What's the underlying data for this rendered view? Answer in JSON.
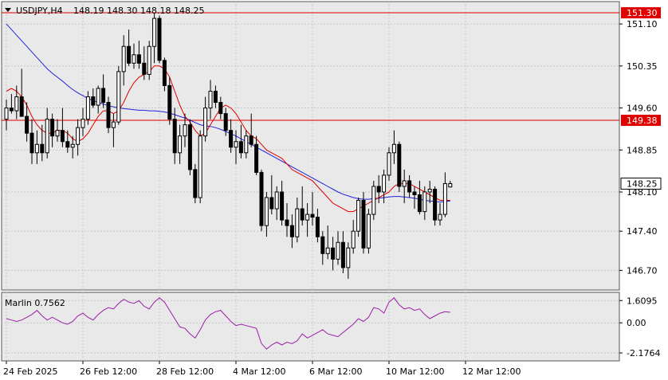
{
  "header": {
    "symbol": "USDJPY,H4",
    "ohlc": "148.19 148.30 148.18 148.25"
  },
  "colors": {
    "background": "#e9e9e9",
    "grid": "#c8c8c8",
    "candle": "#000000",
    "ma_fast": "#e00000",
    "ma_slow": "#2222dd",
    "level": "#e00000",
    "level_label_bg": "#e00000",
    "price_label_bg": "#ffffff",
    "oscillator": "#9b1fa8"
  },
  "chart_data": [
    {
      "type": "candlestick",
      "title": "USDJPY,H4",
      "ylim": [
        146.35,
        151.5
      ],
      "y_ticks": [
        "151.10",
        "150.35",
        "149.60",
        "148.85",
        "148.10",
        "147.40",
        "146.70"
      ],
      "x_ticks": [
        "24 Feb 2025",
        "26 Feb 12:00",
        "28 Feb 12:00",
        "4 Mar 12:00",
        "6 Mar 12:00",
        "10 Mar 12:00",
        "12 Mar 12:00"
      ],
      "x_tick_index": [
        0,
        15,
        30,
        45,
        60,
        75,
        90
      ],
      "horizontal_levels": [
        {
          "label": "151.30",
          "value": 151.3
        },
        {
          "label": "149.38",
          "value": 149.38
        }
      ],
      "current_price": {
        "label": "148.25",
        "value": 148.25
      },
      "candles": [
        [
          149.4,
          149.75,
          149.2,
          149.6
        ],
        [
          149.6,
          149.85,
          149.5,
          149.55
        ],
        [
          149.55,
          150.0,
          149.4,
          149.8
        ],
        [
          149.8,
          150.3,
          149.5,
          149.45
        ],
        [
          149.45,
          149.7,
          149.0,
          149.15
        ],
        [
          149.15,
          149.4,
          148.6,
          148.8
        ],
        [
          148.8,
          149.2,
          148.6,
          148.95
        ],
        [
          148.95,
          149.3,
          148.65,
          148.8
        ],
        [
          148.8,
          149.6,
          148.7,
          149.4
        ],
        [
          149.4,
          149.5,
          148.9,
          149.1
        ],
        [
          149.1,
          149.4,
          149.0,
          149.2
        ],
        [
          149.2,
          149.6,
          148.9,
          149.0
        ],
        [
          149.0,
          149.2,
          148.8,
          148.9
        ],
        [
          148.9,
          149.1,
          148.7,
          148.95
        ],
        [
          148.95,
          149.4,
          148.75,
          149.25
        ],
        [
          149.25,
          149.6,
          149.1,
          149.4
        ],
        [
          149.4,
          149.9,
          149.3,
          149.8
        ],
        [
          149.8,
          149.95,
          149.6,
          149.65
        ],
        [
          149.65,
          150.0,
          149.5,
          149.95
        ],
        [
          149.95,
          150.2,
          149.6,
          149.7
        ],
        [
          149.7,
          149.8,
          149.15,
          149.25
        ],
        [
          149.25,
          149.5,
          148.9,
          149.35
        ],
        [
          149.35,
          150.35,
          149.3,
          150.25
        ],
        [
          150.25,
          150.9,
          150.0,
          150.7
        ],
        [
          150.7,
          151.0,
          150.35,
          150.4
        ],
        [
          150.4,
          150.75,
          150.3,
          150.55
        ],
        [
          150.55,
          150.8,
          150.3,
          150.4
        ],
        [
          150.4,
          150.7,
          150.1,
          150.2
        ],
        [
          150.2,
          150.8,
          150.1,
          150.7
        ],
        [
          150.7,
          151.3,
          150.4,
          151.2
        ],
        [
          151.2,
          151.25,
          150.4,
          150.45
        ],
        [
          150.45,
          150.5,
          149.9,
          150.0
        ],
        [
          150.0,
          150.15,
          149.3,
          149.4
        ],
        [
          149.4,
          149.6,
          148.6,
          148.8
        ],
        [
          148.8,
          149.3,
          148.6,
          149.1
        ],
        [
          149.1,
          149.5,
          148.9,
          149.3
        ],
        [
          149.3,
          149.4,
          148.4,
          148.5
        ],
        [
          148.5,
          148.6,
          147.9,
          148.0
        ],
        [
          148.0,
          149.2,
          147.9,
          149.1
        ],
        [
          149.1,
          149.8,
          149.0,
          149.6
        ],
        [
          149.6,
          150.1,
          149.4,
          149.9
        ],
        [
          149.9,
          150.0,
          149.6,
          149.7
        ],
        [
          149.7,
          149.8,
          149.4,
          149.5
        ],
        [
          149.5,
          149.6,
          149.1,
          149.2
        ],
        [
          149.2,
          149.4,
          148.8,
          148.9
        ],
        [
          148.9,
          149.2,
          148.6,
          149.0
        ],
        [
          149.0,
          149.3,
          148.7,
          148.8
        ],
        [
          148.8,
          149.2,
          148.7,
          149.1
        ],
        [
          149.1,
          149.5,
          148.9,
          148.95
        ],
        [
          148.95,
          149.1,
          148.4,
          148.45
        ],
        [
          148.45,
          148.5,
          147.4,
          147.5
        ],
        [
          147.5,
          148.1,
          147.3,
          148.0
        ],
        [
          148.0,
          148.4,
          147.7,
          147.8
        ],
        [
          147.8,
          148.2,
          147.6,
          148.1
        ],
        [
          148.1,
          148.3,
          147.5,
          147.6
        ],
        [
          147.6,
          147.9,
          147.3,
          147.5
        ],
        [
          147.5,
          147.7,
          147.1,
          147.3
        ],
        [
          147.3,
          148.0,
          147.2,
          147.8
        ],
        [
          147.8,
          148.2,
          147.5,
          147.6
        ],
        [
          147.6,
          147.9,
          147.3,
          147.7
        ],
        [
          147.7,
          148.1,
          147.5,
          147.65
        ],
        [
          147.65,
          147.8,
          147.2,
          147.3
        ],
        [
          147.3,
          147.4,
          146.8,
          147.0
        ],
        [
          147.0,
          147.5,
          146.9,
          147.1
        ],
        [
          147.1,
          147.3,
          146.7,
          146.9
        ],
        [
          146.9,
          147.4,
          146.8,
          147.2
        ],
        [
          147.2,
          147.4,
          146.65,
          146.75
        ],
        [
          146.75,
          147.2,
          146.55,
          147.1
        ],
        [
          147.1,
          147.6,
          147.0,
          147.4
        ],
        [
          147.4,
          148.0,
          147.3,
          147.95
        ],
        [
          147.95,
          148.1,
          147.0,
          147.1
        ],
        [
          147.1,
          147.8,
          147.0,
          147.7
        ],
        [
          147.7,
          148.3,
          147.6,
          148.2
        ],
        [
          148.2,
          148.4,
          147.9,
          148.1
        ],
        [
          148.1,
          148.5,
          147.9,
          148.4
        ],
        [
          148.4,
          148.9,
          148.3,
          148.8
        ],
        [
          148.8,
          149.2,
          148.6,
          148.95
        ],
        [
          148.95,
          149.0,
          148.1,
          148.2
        ],
        [
          148.2,
          148.5,
          147.9,
          148.3
        ],
        [
          148.3,
          148.4,
          148.0,
          148.1
        ],
        [
          148.1,
          148.2,
          147.8,
          148.05
        ],
        [
          148.05,
          148.3,
          147.7,
          147.75
        ],
        [
          147.75,
          148.2,
          147.6,
          148.1
        ],
        [
          148.1,
          148.3,
          147.9,
          148.15
        ],
        [
          148.15,
          148.2,
          147.5,
          147.6
        ],
        [
          147.6,
          147.9,
          147.5,
          147.7
        ],
        [
          147.7,
          148.45,
          147.65,
          148.25
        ],
        [
          148.19,
          148.3,
          148.18,
          148.25
        ]
      ],
      "ma_fast": [
        149.9,
        149.95,
        149.9,
        149.8,
        149.65,
        149.45,
        149.3,
        149.2,
        149.15,
        149.15,
        149.2,
        149.2,
        149.15,
        149.05,
        149.0,
        149.05,
        149.15,
        149.3,
        149.45,
        149.55,
        149.55,
        149.5,
        149.55,
        149.7,
        149.9,
        150.05,
        150.15,
        150.2,
        150.25,
        150.35,
        150.35,
        150.3,
        150.15,
        149.9,
        149.65,
        149.45,
        149.35,
        149.2,
        149.1,
        149.15,
        149.3,
        149.45,
        149.6,
        149.65,
        149.6,
        149.5,
        149.35,
        149.2,
        149.1,
        149.05,
        148.95,
        148.85,
        148.8,
        148.75,
        148.7,
        148.6,
        148.5,
        148.45,
        148.4,
        148.35,
        148.3,
        148.2,
        148.1,
        148.0,
        147.9,
        147.85,
        147.8,
        147.75,
        147.75,
        147.8,
        147.85,
        147.9,
        147.95,
        148.0,
        148.05,
        148.1,
        148.2,
        148.25,
        148.25,
        148.25,
        148.2,
        148.15,
        148.1,
        148.05,
        148.0,
        147.95,
        147.95,
        147.95
      ],
      "ma_slow": [
        151.1,
        151.0,
        150.9,
        150.8,
        150.7,
        150.6,
        150.5,
        150.4,
        150.3,
        150.22,
        150.15,
        150.08,
        150.0,
        149.93,
        149.87,
        149.82,
        149.77,
        149.73,
        149.7,
        149.67,
        149.64,
        149.62,
        149.6,
        149.59,
        149.58,
        149.57,
        149.56,
        149.56,
        149.55,
        149.55,
        149.54,
        149.53,
        149.51,
        149.48,
        149.45,
        149.42,
        149.38,
        149.34,
        149.3,
        149.28,
        149.27,
        149.25,
        149.22,
        149.18,
        149.14,
        149.1,
        149.05,
        149.0,
        148.95,
        148.9,
        148.85,
        148.8,
        148.75,
        148.7,
        148.65,
        148.6,
        148.55,
        148.5,
        148.45,
        148.4,
        148.35,
        148.3,
        148.25,
        148.2,
        148.15,
        148.1,
        148.06,
        148.03,
        148.0,
        147.98,
        147.97,
        147.97,
        147.98,
        147.99,
        148.0,
        148.01,
        148.02,
        148.02,
        148.01,
        148.0,
        147.99,
        147.97,
        147.95,
        147.94,
        147.93,
        147.92,
        147.93,
        147.94
      ]
    },
    {
      "type": "line",
      "title": "Marlin 0.7562",
      "ylim": [
        -2.75,
        2.2
      ],
      "y_ticks": [
        "1.6095",
        "0.00",
        "-2.1764"
      ],
      "series": [
        {
          "values": [
            0.3,
            0.2,
            0.1,
            0.2,
            0.4,
            0.6,
            0.9,
            0.5,
            0.2,
            0.4,
            0.2,
            0.0,
            -0.1,
            0.1,
            0.5,
            0.7,
            0.4,
            0.2,
            0.6,
            0.9,
            1.1,
            1.0,
            1.4,
            1.7,
            1.5,
            1.4,
            1.6,
            1.2,
            1.0,
            1.5,
            1.8,
            1.5,
            0.9,
            0.3,
            -0.3,
            -0.4,
            -0.8,
            -1.1,
            -0.5,
            0.2,
            0.6,
            0.8,
            0.9,
            0.5,
            0.1,
            -0.2,
            -0.1,
            -0.2,
            -0.3,
            -0.4,
            -1.5,
            -1.9,
            -1.6,
            -1.4,
            -1.6,
            -1.4,
            -1.5,
            -1.3,
            -0.8,
            -1.1,
            -0.9,
            -0.7,
            -0.5,
            -0.8,
            -0.9,
            -1.0,
            -0.7,
            -0.4,
            -0.1,
            0.3,
            0.1,
            0.4,
            1.1,
            1.0,
            0.7,
            1.5,
            1.8,
            1.3,
            1.0,
            1.1,
            0.9,
            1.0,
            0.6,
            0.3,
            0.5,
            0.7,
            0.8,
            0.76
          ]
        }
      ]
    }
  ]
}
